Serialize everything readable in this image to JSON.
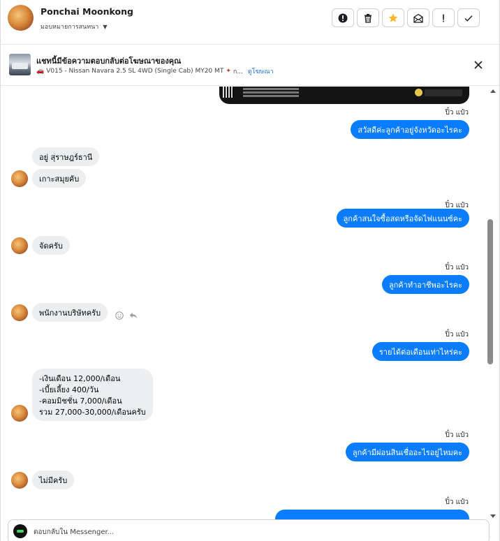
{
  "header": {
    "contact_name": "Ponchai Moonkong",
    "assign_label": "มอบหมายการสนทนา",
    "actions": [
      {
        "name": "report-icon",
        "label": "report"
      },
      {
        "name": "trash-icon",
        "label": "delete"
      },
      {
        "name": "star-icon",
        "label": "star"
      },
      {
        "name": "mark-unread-icon",
        "label": "mark unread"
      },
      {
        "name": "important-icon",
        "label": "important"
      },
      {
        "name": "check-icon",
        "label": "done"
      }
    ],
    "accent_color": "#f7b928"
  },
  "ad_banner": {
    "title": "แชทนี้มีข้อความตอบกลับต่อโฆษณาของคุณ",
    "ad_line": "V015 - Nissan Navara 2.5 SL 4WD (Single Cab) MY20 MT",
    "ad_line_suffix": "ก...",
    "link_label": "ดูโฆษณา"
  },
  "thread": {
    "seen_label": "ปิ๋ว แป๋ว",
    "messages": [
      {
        "dir": "out",
        "text": "สวัสดีค่ะลูกค้าอยู่จังหวัดอะไรคะ"
      },
      {
        "dir": "in",
        "text": "อยู่ สุราษฎร์ธานี"
      },
      {
        "dir": "in",
        "text": "เกาะสมุยคับ"
      },
      {
        "dir": "out",
        "text": "ลูกค้าสนใจซื้อสดหรือจัดไฟแนนซ์คะ"
      },
      {
        "dir": "in",
        "text": "จัดครับ"
      },
      {
        "dir": "out",
        "text": "ลูกค้าทำอาชีพอะไรคะ"
      },
      {
        "dir": "in",
        "text": "พนักงานบริษัทครับ"
      },
      {
        "dir": "out",
        "text": "รายได้ต่อเดือนเท่าไหร่คะ"
      },
      {
        "dir": "in",
        "lines": [
          "-เงินเดือน 12,000/เดือน",
          "-เบี้ยเลี้ยง 400/วัน",
          "-คอมมิชชั่น 7,000/เดือน",
          "รวม 27,000-30,000/เดือนครับ"
        ]
      },
      {
        "dir": "out",
        "text": "ลูกค้ามีผ่อนสินเชื่ออะไรอยู่ไหมคะ"
      },
      {
        "dir": "in",
        "text": "ไม่มีครับ"
      }
    ],
    "bubble_out_color": "#0a7cff",
    "bubble_in_color": "#eceef0"
  },
  "composer": {
    "placeholder": "ตอบกลับใน Messenger..."
  }
}
